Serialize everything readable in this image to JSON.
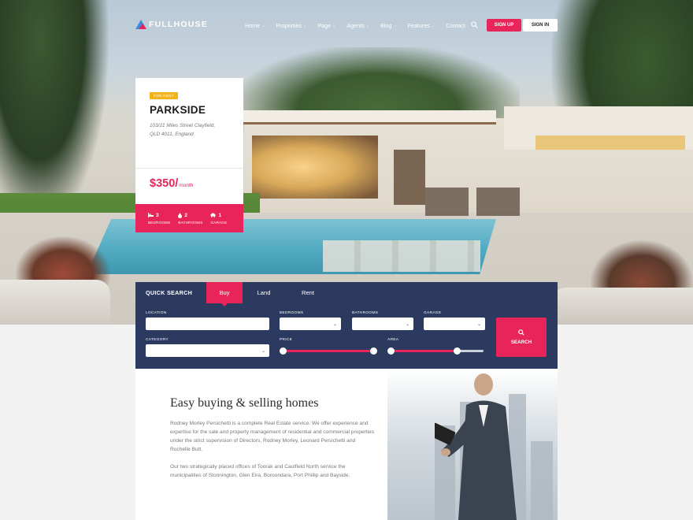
{
  "brand": {
    "name": "FULLHOUSE",
    "accent": "#e9245a",
    "navy": "#2b3a5e",
    "badge_color": "#f2b21b"
  },
  "nav": {
    "items": [
      {
        "label": "Home"
      },
      {
        "label": "Properties"
      },
      {
        "label": "Page"
      },
      {
        "label": "Agents"
      },
      {
        "label": "Blog"
      },
      {
        "label": "Features"
      },
      {
        "label": "Contact"
      }
    ],
    "caret": "⌄",
    "signup": "SIGN UP",
    "signin": "SIGN IN"
  },
  "property": {
    "badge": "FOR RENT",
    "title": "PARKSIDE",
    "address_line1": "103/21 Miles Street Clayfield,",
    "address_line2": "QLD 4011, England",
    "price": "$350/",
    "price_unit": "month",
    "features": [
      {
        "count": "3",
        "label": "BEDROOMS",
        "icon": "bed-icon"
      },
      {
        "count": "2",
        "label": "BATHROOMS",
        "icon": "water-drop-icon"
      },
      {
        "count": "1",
        "label": "GARAGE",
        "icon": "car-icon"
      }
    ]
  },
  "quick_search": {
    "title": "QUICK SEARCH",
    "tabs": [
      "Buy",
      "Land",
      "Rent"
    ],
    "active_tab": "Buy",
    "labels": {
      "location": "LOCATION",
      "bedrooms": "BEDROOMS",
      "bathrooms": "BATHROOMS",
      "garage": "GARAGE",
      "category": "CATEGORY",
      "price": "PRICE",
      "area": "AREA"
    },
    "search_button": "SEARCH"
  },
  "intro": {
    "heading": "Easy buying & selling homes",
    "paragraph1": "Rodney Morley Persichetti is a complete Real Estate service. We offer experience and expertise for the sale and property management of residential and commercial properties under the strict supervision of Directors, Rodney Morley, Leonard Persichetti and Rochelle Butt.",
    "paragraph2": "Our two strategically placed offices of Toorak and Caulfield North service the municipalities of Stonnington, Glen Eira, Boroondara, Port Phillip and Bayside."
  }
}
